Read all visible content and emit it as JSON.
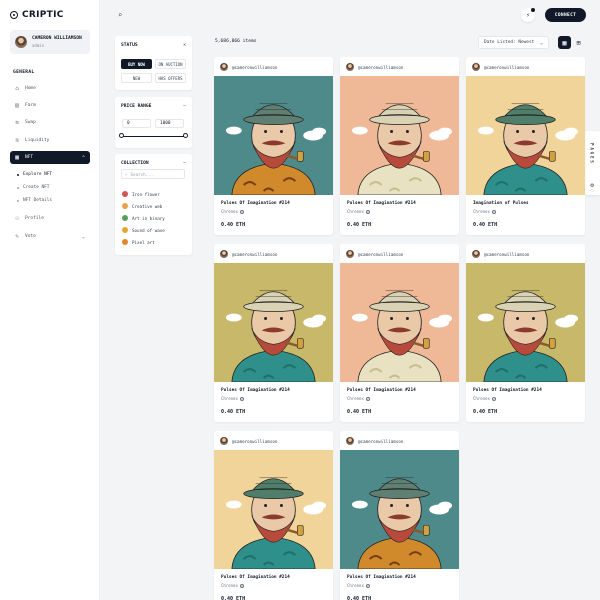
{
  "brand": "CRIPTIC",
  "profile": {
    "name": "CAMERON WILLIAMSON",
    "role": "admin"
  },
  "nav": {
    "heading": "GENERAL",
    "items": [
      {
        "label": "Home",
        "icon": "home-icon"
      },
      {
        "label": "Farm",
        "icon": "farm-icon"
      },
      {
        "label": "Swap",
        "icon": "swap-icon"
      },
      {
        "label": "Liquidity",
        "icon": "liquidity-icon"
      },
      {
        "label": "NFT",
        "icon": "nft-icon"
      }
    ],
    "subitems": [
      {
        "label": "Explore NFT"
      },
      {
        "label": "Create NFT"
      },
      {
        "label": "NFT Details"
      }
    ],
    "profile": {
      "label": "Profile",
      "icon": "profile-icon"
    },
    "vote": {
      "label": "Vote",
      "icon": "vote-icon"
    }
  },
  "topbar": {
    "connect_label": "CONNECT"
  },
  "filters": {
    "status": {
      "title": "STATUS",
      "options": [
        "BUY NOW",
        "ON AUCTION",
        "NEW",
        "HAS OFFERS"
      ]
    },
    "price": {
      "title": "PRICE RANGE",
      "min": "0",
      "max": "1000"
    },
    "collection": {
      "title": "COLLECTION",
      "search_placeholder": "Search...",
      "items": [
        {
          "label": "Iron flower",
          "color": "#d35454"
        },
        {
          "label": "Creative web",
          "color": "#e6a44a"
        },
        {
          "label": "Art in binary",
          "color": "#5aa05a"
        },
        {
          "label": "Sound of wave",
          "color": "#e3a72f"
        },
        {
          "label": "Pixel art",
          "color": "#e1862e"
        }
      ]
    }
  },
  "results": {
    "count": "5,686,066 items",
    "sort": "Date Listed: Newest"
  },
  "right_tab": {
    "label": "PAGES"
  },
  "cards": [
    {
      "owner": "@cameronwilliamson",
      "title": "Pulses Of Imagination #214",
      "creator": "Chrenex",
      "price": "0.40 ETH",
      "variant": "teal"
    },
    {
      "owner": "@cameronwilliamson",
      "title": "Pulses Of Imagination #214",
      "creator": "Chrenex",
      "price": "0.40 ETH",
      "variant": "peach"
    },
    {
      "owner": "@cameronwilliamson",
      "title": "Imagination of Pulses",
      "creator": "Chrenex",
      "price": "0.40 ETH",
      "variant": "sand"
    },
    {
      "owner": "@cameronwilliamson",
      "title": "Pulses Of Imagination #214",
      "creator": "Chrenex",
      "price": "0.40 ETH",
      "variant": "olive"
    },
    {
      "owner": "@cameronwilliamson",
      "title": "Pulses Of Imagination #214",
      "creator": "Chrenex",
      "price": "0.40 ETH",
      "variant": "peach"
    },
    {
      "owner": "@cameronwilliamson",
      "title": "Pulses Of Imagination #214",
      "creator": "Chrenex",
      "price": "0.40 ETH",
      "variant": "olive"
    },
    {
      "owner": "@cameronwilliamson",
      "title": "Pulses Of Imagination #214",
      "creator": "Chrenex",
      "price": "0.40 ETH",
      "variant": "sand"
    },
    {
      "owner": "@cameronwilliamson",
      "title": "Pulses Of Imagination #214",
      "creator": "Chrenex",
      "price": "0.40 ETH",
      "variant": "teal"
    }
  ]
}
